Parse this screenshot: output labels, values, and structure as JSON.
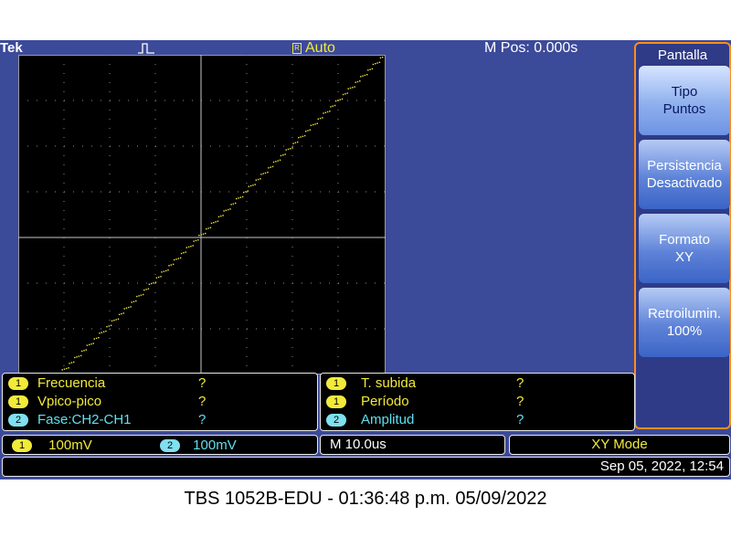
{
  "topbar": {
    "brand": "Tek",
    "trigger_icon": "rising-edge-pulse-icon",
    "acquisition_icon": "run-status-icon",
    "acquisition_mode": "Auto",
    "horizontal_position": "M Pos: 0.000s"
  },
  "side_menu": {
    "title": "Pantalla",
    "buttons": [
      {
        "line1": "Tipo",
        "line2": "Puntos"
      },
      {
        "line1": "Persistencia",
        "line2": "Desactivado"
      },
      {
        "line1": "Formato",
        "line2": "XY"
      },
      {
        "line1": "Retroilumin.",
        "line2": "100%"
      }
    ]
  },
  "measurements": {
    "left": [
      {
        "channel": "1",
        "name": "Frecuencia",
        "value": "?"
      },
      {
        "channel": "1",
        "name": "Vpico-pico",
        "value": "?"
      },
      {
        "channel": "2",
        "name": "Fase:CH2-CH1",
        "value": "?"
      }
    ],
    "right": [
      {
        "channel": "1",
        "name": "T. subida",
        "value": "?"
      },
      {
        "channel": "1",
        "name": "Período",
        "value": "?"
      },
      {
        "channel": "2",
        "name": "Amplitud",
        "value": "?"
      }
    ]
  },
  "status": {
    "ch1_label": "1",
    "ch1_scale": "100mV",
    "ch2_label": "2",
    "ch2_scale": "100mV",
    "timebase": "M 10.0us",
    "mode": "XY Mode",
    "datetime": "Sep 05, 2022, 12:54"
  },
  "caption": "TBS 1052B-EDU - 01:36:48 p.m.   05/09/2022",
  "colors": {
    "screen_bg": "#3c4a9a",
    "ch1": "#f2ea3a",
    "ch2": "#5fe0f0",
    "menu_border": "#ff8c1a"
  },
  "plot": {
    "mode": "XY",
    "trace_shape": "straight diagonal line",
    "trace_color": "#f2ea3a",
    "graticule": "4 x 7 divisions, dotted"
  }
}
